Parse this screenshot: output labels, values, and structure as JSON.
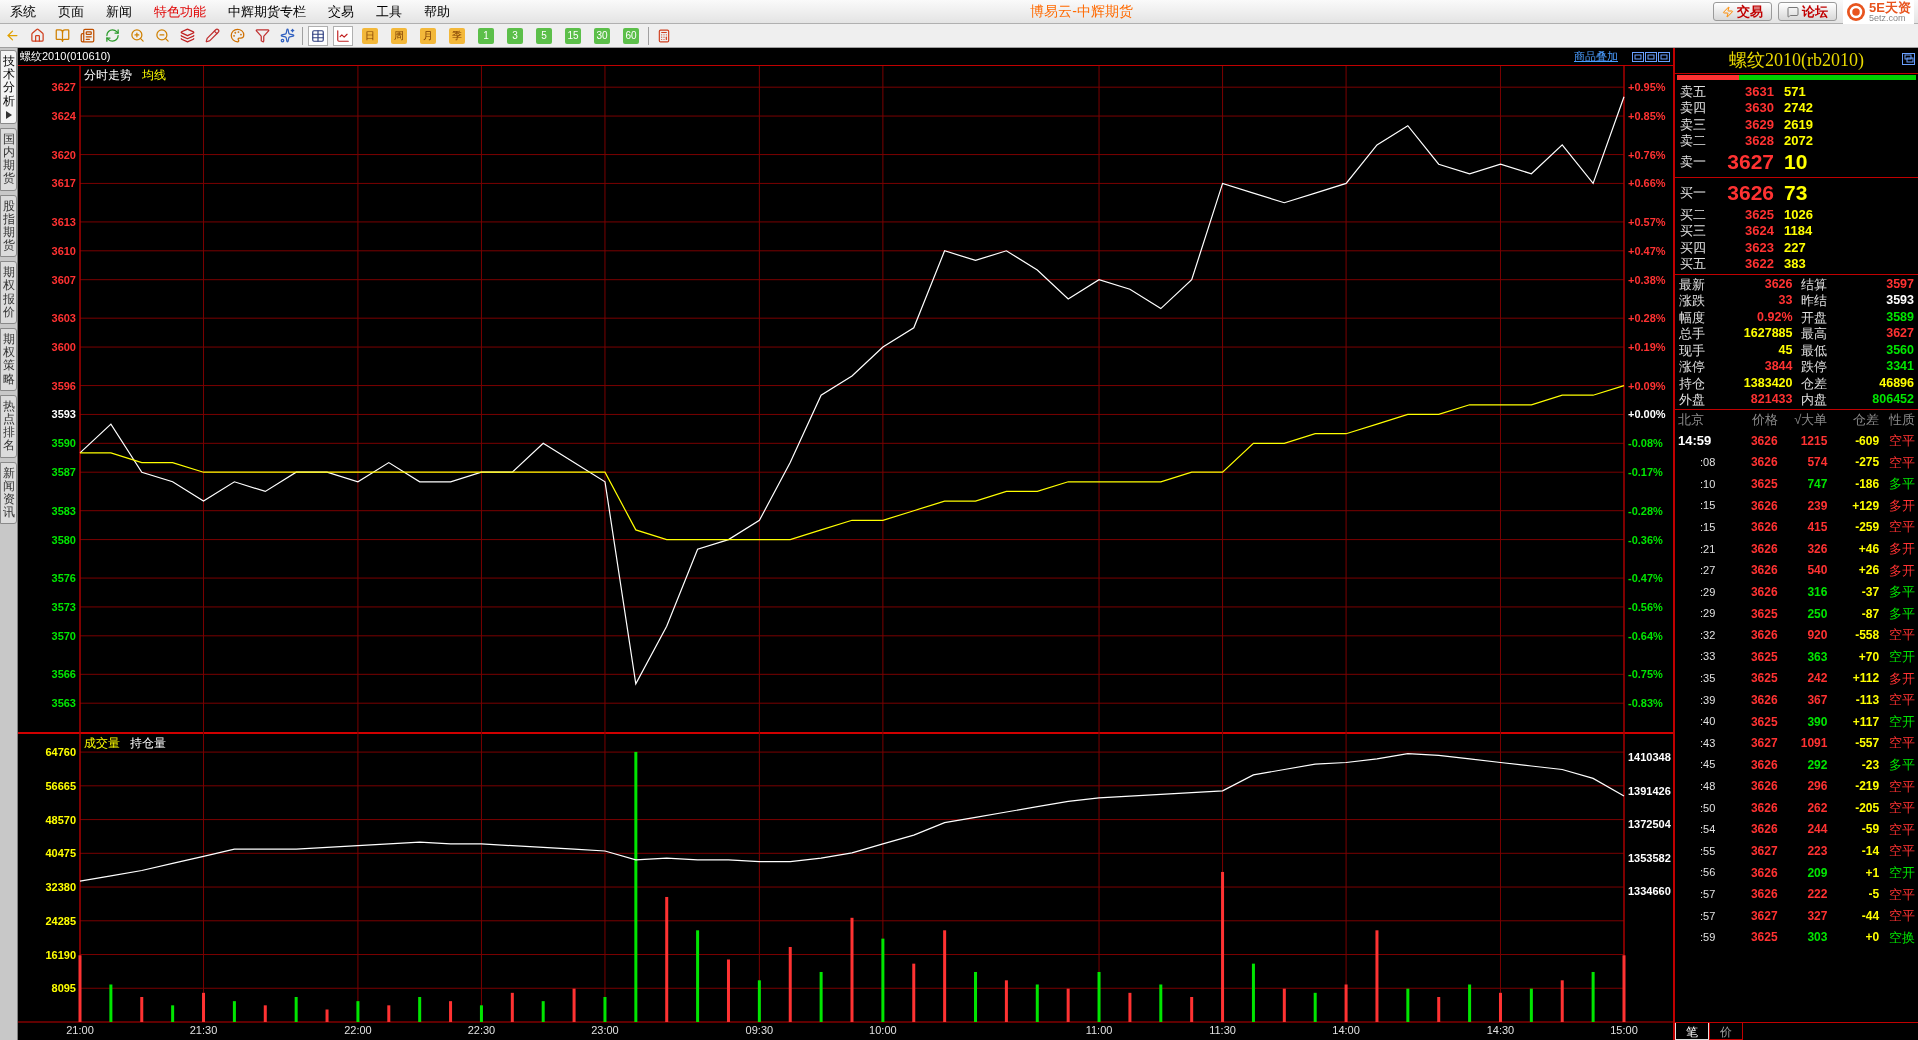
{
  "menu_bar": {
    "items": [
      {
        "label": "系统",
        "active": false
      },
      {
        "label": "页面",
        "active": false
      },
      {
        "label": "新闻",
        "active": false
      },
      {
        "label": "特色功能",
        "active": true
      },
      {
        "label": "中辉期货专栏",
        "active": false
      },
      {
        "label": "交易",
        "active": false
      },
      {
        "label": "工具",
        "active": false
      },
      {
        "label": "帮助",
        "active": false
      }
    ],
    "title": "博易云-中辉期货",
    "buttons": [
      "交易",
      "论坛"
    ],
    "logo": {
      "name": "5E天资",
      "url": "5etz.com"
    }
  },
  "toolbar": {
    "buttons": [
      "日",
      "周",
      "月",
      "季",
      "1",
      "3",
      "5",
      "15",
      "30",
      "60"
    ]
  },
  "side_tabs": [
    {
      "label": "技术分析",
      "selected": true
    },
    {
      "label": "国内期货",
      "selected": false
    },
    {
      "label": "股指期货",
      "selected": false
    },
    {
      "label": "期权报价",
      "selected": false
    },
    {
      "label": "期权策略",
      "selected": false
    },
    {
      "label": "热点排名",
      "selected": false
    },
    {
      "label": "新闻资讯",
      "selected": false
    }
  ],
  "chart_header": {
    "symbol": "螺纹2010(010610)",
    "overlay_link": "商品叠加"
  },
  "price_pane": {
    "percent_axis": [
      {
        "text": "+0.95%",
        "color": "#ff3232"
      },
      {
        "text": "+0.85%",
        "color": "#ff3232"
      },
      {
        "text": "+0.76%",
        "color": "#ff3232"
      },
      {
        "text": "+0.66%",
        "color": "#ff3232"
      },
      {
        "text": "+0.57%",
        "color": "#ff3232"
      },
      {
        "text": "+0.47%",
        "color": "#ff3232"
      },
      {
        "text": "+0.38%",
        "color": "#ff3232"
      },
      {
        "text": "+0.28%",
        "color": "#ff3232"
      },
      {
        "text": "+0.19%",
        "color": "#ff3232"
      },
      {
        "text": "+0.09%",
        "color": "#ff3232"
      },
      {
        "text": "+0.00%",
        "color": "#ffffff"
      },
      {
        "text": "-0.08%",
        "color": "#00e600"
      },
      {
        "text": "-0.17%",
        "color": "#00e600"
      },
      {
        "text": "-0.28%",
        "color": "#00e600"
      },
      {
        "text": "-0.36%",
        "color": "#00e600"
      },
      {
        "text": "-0.47%",
        "color": "#00e600"
      },
      {
        "text": "-0.56%",
        "color": "#00e600"
      },
      {
        "text": "-0.64%",
        "color": "#00e600"
      },
      {
        "text": "-0.75%",
        "color": "#00e600"
      },
      {
        "text": "-0.83%",
        "color": "#00e600"
      }
    ],
    "chart_data": {
      "type": "line",
      "grid": true,
      "ylim": [
        3559.8,
        3629.2
      ],
      "yticks": [
        3627,
        3624,
        3620,
        3617,
        3613,
        3610,
        3607,
        3603,
        3600,
        3596,
        3593,
        3590,
        3587,
        3583,
        3580,
        3576,
        3573,
        3570,
        3566,
        3563
      ],
      "series": [
        {
          "name": "分时走势",
          "color": "#ffffff",
          "values": [
            3589,
            3592,
            3587,
            3586,
            3584,
            3586,
            3585,
            3587,
            3587,
            3586,
            3588,
            3586,
            3586,
            3587,
            3587,
            3590,
            3588,
            3586,
            3565,
            3571,
            3579,
            3580,
            3582,
            3588,
            3595,
            3597,
            3600,
            3602,
            3610,
            3609,
            3610,
            3608,
            3605,
            3607,
            3606,
            3604,
            3607,
            3617,
            3616,
            3615,
            3616,
            3617,
            3621,
            3623,
            3619,
            3618,
            3619,
            3618,
            3621,
            3617,
            3626
          ]
        },
        {
          "name": "均线",
          "color": "#ffff00",
          "values": [
            3589,
            3589,
            3588,
            3588,
            3587,
            3587,
            3587,
            3587,
            3587,
            3587,
            3587,
            3587,
            3587,
            3587,
            3587,
            3587,
            3587,
            3587,
            3581,
            3580,
            3580,
            3580,
            3580,
            3580,
            3581,
            3582,
            3582,
            3583,
            3584,
            3584,
            3585,
            3585,
            3586,
            3586,
            3586,
            3586,
            3587,
            3587,
            3590,
            3590,
            3591,
            3591,
            3592,
            3593,
            3593,
            3594,
            3594,
            3594,
            3595,
            3595,
            3596
          ]
        }
      ]
    }
  },
  "volume_pane": {
    "chart_data": {
      "type": "bar",
      "grid": true,
      "ylim": [
        0,
        69100
      ],
      "yticks": [
        64760,
        56665,
        48570,
        40475,
        32380,
        24285,
        16190,
        8095
      ],
      "categories": [
        "21:00",
        null,
        null,
        null,
        "21:30",
        null,
        null,
        null,
        null,
        "22:00",
        null,
        null,
        null,
        "22:30",
        null,
        null,
        null,
        "23:00",
        null,
        null,
        null,
        null,
        "09:30",
        null,
        null,
        null,
        "10:00",
        null,
        null,
        null,
        null,
        null,
        null,
        "11:00",
        null,
        null,
        null,
        "11:30",
        null,
        null,
        null,
        "14:00",
        null,
        null,
        null,
        null,
        "14:30",
        null,
        null,
        null,
        "15:00"
      ],
      "series": [
        {
          "name": "成交量",
          "color": "#ff3232",
          "values": [
            16000,
            null,
            6000,
            null,
            7000,
            null,
            4000,
            null,
            3000,
            null,
            4000,
            null,
            5000,
            null,
            7000,
            null,
            8000,
            null,
            null,
            30000,
            null,
            15000,
            null,
            18000,
            null,
            25000,
            null,
            14000,
            22000,
            null,
            10000,
            null,
            8000,
            null,
            7000,
            null,
            6000,
            36000,
            null,
            8000,
            null,
            9000,
            22000,
            null,
            6000,
            null,
            7000,
            null,
            10000,
            null,
            16000
          ]
        },
        {
          "color": "#00e600",
          "values": [
            null,
            9000,
            null,
            4000,
            null,
            5000,
            null,
            6000,
            null,
            5000,
            null,
            6000,
            null,
            4000,
            null,
            5000,
            null,
            6000,
            64800,
            null,
            22000,
            null,
            10000,
            null,
            12000,
            null,
            20000,
            null,
            null,
            12000,
            null,
            9000,
            null,
            12000,
            null,
            9000,
            null,
            null,
            14000,
            null,
            7000,
            null,
            null,
            8000,
            null,
            9000,
            null,
            8000,
            null,
            12000,
            null
          ]
        }
      ]
    },
    "open_interest": {
      "chart_data": {
        "type": "line",
        "ylim": [
          1334660,
          1410348
        ],
        "yticks": [
          1410348,
          1391426,
          1372504,
          1353582,
          1334660
        ],
        "series": [
          {
            "name": "持仓量",
            "color": "#ffffff",
            "values": [
              1338000,
              1341000,
              1344000,
              1348000,
              1352000,
              1356000,
              1356000,
              1356000,
              1357000,
              1358000,
              1359000,
              1360000,
              1359000,
              1359000,
              1358000,
              1357000,
              1356000,
              1355000,
              1350000,
              1351000,
              1350000,
              1350000,
              1349000,
              1349000,
              1351000,
              1354000,
              1359000,
              1364000,
              1371000,
              1374000,
              1377000,
              1380000,
              1383000,
              1385000,
              1386000,
              1387000,
              1388000,
              1389000,
              1398000,
              1401000,
              1404000,
              1405000,
              1407000,
              1410000,
              1409000,
              1407000,
              1405000,
              1403000,
              1401000,
              1396000,
              1386000
            ]
          }
        ]
      }
    }
  },
  "quote_panel": {
    "title": "螺纹2010(rb2010)",
    "strength_bar": {
      "level": 0.26
    },
    "asks": [
      {
        "label": "卖五",
        "price": "3631",
        "volume": "571",
        "best": false
      },
      {
        "label": "卖四",
        "price": "3630",
        "volume": "2742",
        "best": false
      },
      {
        "label": "卖三",
        "price": "3629",
        "volume": "2619",
        "best": false
      },
      {
        "label": "卖二",
        "price": "3628",
        "volume": "2072",
        "best": false
      },
      {
        "label": "卖一",
        "price": "3627",
        "volume": "10",
        "best": true
      }
    ],
    "bids": [
      {
        "label": "买一",
        "price": "3626",
        "volume": "73",
        "best": true
      },
      {
        "label": "买二",
        "price": "3625",
        "volume": "1026",
        "best": false
      },
      {
        "label": "买三",
        "price": "3624",
        "volume": "1184",
        "best": false
      },
      {
        "label": "买四",
        "price": "3623",
        "volume": "227",
        "best": false
      },
      {
        "label": "买五",
        "price": "3622",
        "volume": "383",
        "best": false
      }
    ],
    "stats": [
      {
        "label": "最新",
        "value": "3626",
        "color": "#ff3232"
      },
      {
        "label": "结算",
        "value": "3597",
        "color": "#ff3232"
      },
      {
        "label": "涨跌",
        "value": "33",
        "color": "#ff3232"
      },
      {
        "label": "昨结",
        "value": "3593",
        "color": "#ffffff"
      },
      {
        "label": "幅度",
        "value": "0.92%",
        "color": "#ff3232"
      },
      {
        "label": "开盘",
        "value": "3589",
        "color": "#00e600"
      },
      {
        "label": "总手",
        "value": "1627885",
        "color": "#ffff00"
      },
      {
        "label": "最高",
        "value": "3627",
        "color": "#ff3232"
      },
      {
        "label": "现手",
        "value": "45",
        "color": "#ffff00"
      },
      {
        "label": "最低",
        "value": "3560",
        "color": "#00e600"
      },
      {
        "label": "涨停",
        "value": "3844",
        "color": "#ff3232"
      },
      {
        "label": "跌停",
        "value": "3341",
        "color": "#00e600"
      },
      {
        "label": "持仓",
        "value": "1383420",
        "color": "#ffff00"
      },
      {
        "label": "仓差",
        "value": "46896",
        "color": "#ffff00"
      },
      {
        "label": "外盘",
        "value": "821433",
        "color": "#ff3232"
      },
      {
        "label": "内盘",
        "value": "806452",
        "color": "#00e600"
      }
    ],
    "trades": {
      "columns": [
        "北京",
        "价格",
        "√大单",
        "仓差",
        "性质"
      ],
      "rows": [
        {
          "time": "14:59",
          "price": "3626",
          "volume": "1215",
          "oi_change": "-609",
          "nature": "空平",
          "color": "#ff3232"
        },
        {
          "time": ":08",
          "price": "3626",
          "volume": "574",
          "oi_change": "-275",
          "nature": "空平",
          "color": "#ff3232"
        },
        {
          "time": ":10",
          "price": "3625",
          "volume": "747",
          "oi_change": "-186",
          "nature": "多平",
          "color": "#00e600"
        },
        {
          "time": ":15",
          "price": "3626",
          "volume": "239",
          "oi_change": "+129",
          "nature": "多开",
          "color": "#ff3232"
        },
        {
          "time": ":15",
          "price": "3626",
          "volume": "415",
          "oi_change": "-259",
          "nature": "空平",
          "color": "#ff3232"
        },
        {
          "time": ":21",
          "price": "3626",
          "volume": "326",
          "oi_change": "+46",
          "nature": "多开",
          "color": "#ff3232"
        },
        {
          "time": ":27",
          "price": "3626",
          "volume": "540",
          "oi_change": "+26",
          "nature": "多开",
          "color": "#ff3232"
        },
        {
          "time": ":29",
          "price": "3626",
          "volume": "316",
          "oi_change": "-37",
          "nature": "多平",
          "color": "#00e600"
        },
        {
          "time": ":29",
          "price": "3625",
          "volume": "250",
          "oi_change": "-87",
          "nature": "多平",
          "color": "#00e600"
        },
        {
          "time": ":32",
          "price": "3626",
          "volume": "920",
          "oi_change": "-558",
          "nature": "空平",
          "color": "#ff3232"
        },
        {
          "time": ":33",
          "price": "3625",
          "volume": "363",
          "oi_change": "+70",
          "nature": "空开",
          "color": "#00e600"
        },
        {
          "time": ":35",
          "price": "3625",
          "volume": "242",
          "oi_change": "+112",
          "nature": "多开",
          "color": "#ff3232"
        },
        {
          "time": ":39",
          "price": "3626",
          "volume": "367",
          "oi_change": "-113",
          "nature": "空平",
          "color": "#ff3232"
        },
        {
          "time": ":40",
          "price": "3625",
          "volume": "390",
          "oi_change": "+117",
          "nature": "空开",
          "color": "#00e600"
        },
        {
          "time": ":43",
          "price": "3627",
          "volume": "1091",
          "oi_change": "-557",
          "nature": "空平",
          "color": "#ff3232"
        },
        {
          "time": ":45",
          "price": "3626",
          "volume": "292",
          "oi_change": "-23",
          "nature": "多平",
          "color": "#00e600"
        },
        {
          "time": ":48",
          "price": "3626",
          "volume": "296",
          "oi_change": "-219",
          "nature": "空平",
          "color": "#ff3232"
        },
        {
          "time": ":50",
          "price": "3626",
          "volume": "262",
          "oi_change": "-205",
          "nature": "空平",
          "color": "#ff3232"
        },
        {
          "time": ":54",
          "price": "3626",
          "volume": "244",
          "oi_change": "-59",
          "nature": "空平",
          "color": "#ff3232"
        },
        {
          "time": ":55",
          "price": "3627",
          "volume": "223",
          "oi_change": "-14",
          "nature": "空平",
          "color": "#ff3232"
        },
        {
          "time": ":56",
          "price": "3626",
          "volume": "209",
          "oi_change": "+1",
          "nature": "空开",
          "color": "#00e600"
        },
        {
          "time": ":57",
          "price": "3626",
          "volume": "222",
          "oi_change": "-5",
          "nature": "空平",
          "color": "#ff3232"
        },
        {
          "time": ":57",
          "price": "3627",
          "volume": "327",
          "oi_change": "-44",
          "nature": "空平",
          "color": "#ff3232"
        },
        {
          "time": ":59",
          "price": "3625",
          "volume": "303",
          "oi_change": "+0",
          "nature": "空换",
          "color": "#00e600"
        }
      ]
    },
    "tabs": [
      {
        "label": "笔",
        "selected": true
      },
      {
        "label": "价",
        "selected": false
      }
    ]
  }
}
